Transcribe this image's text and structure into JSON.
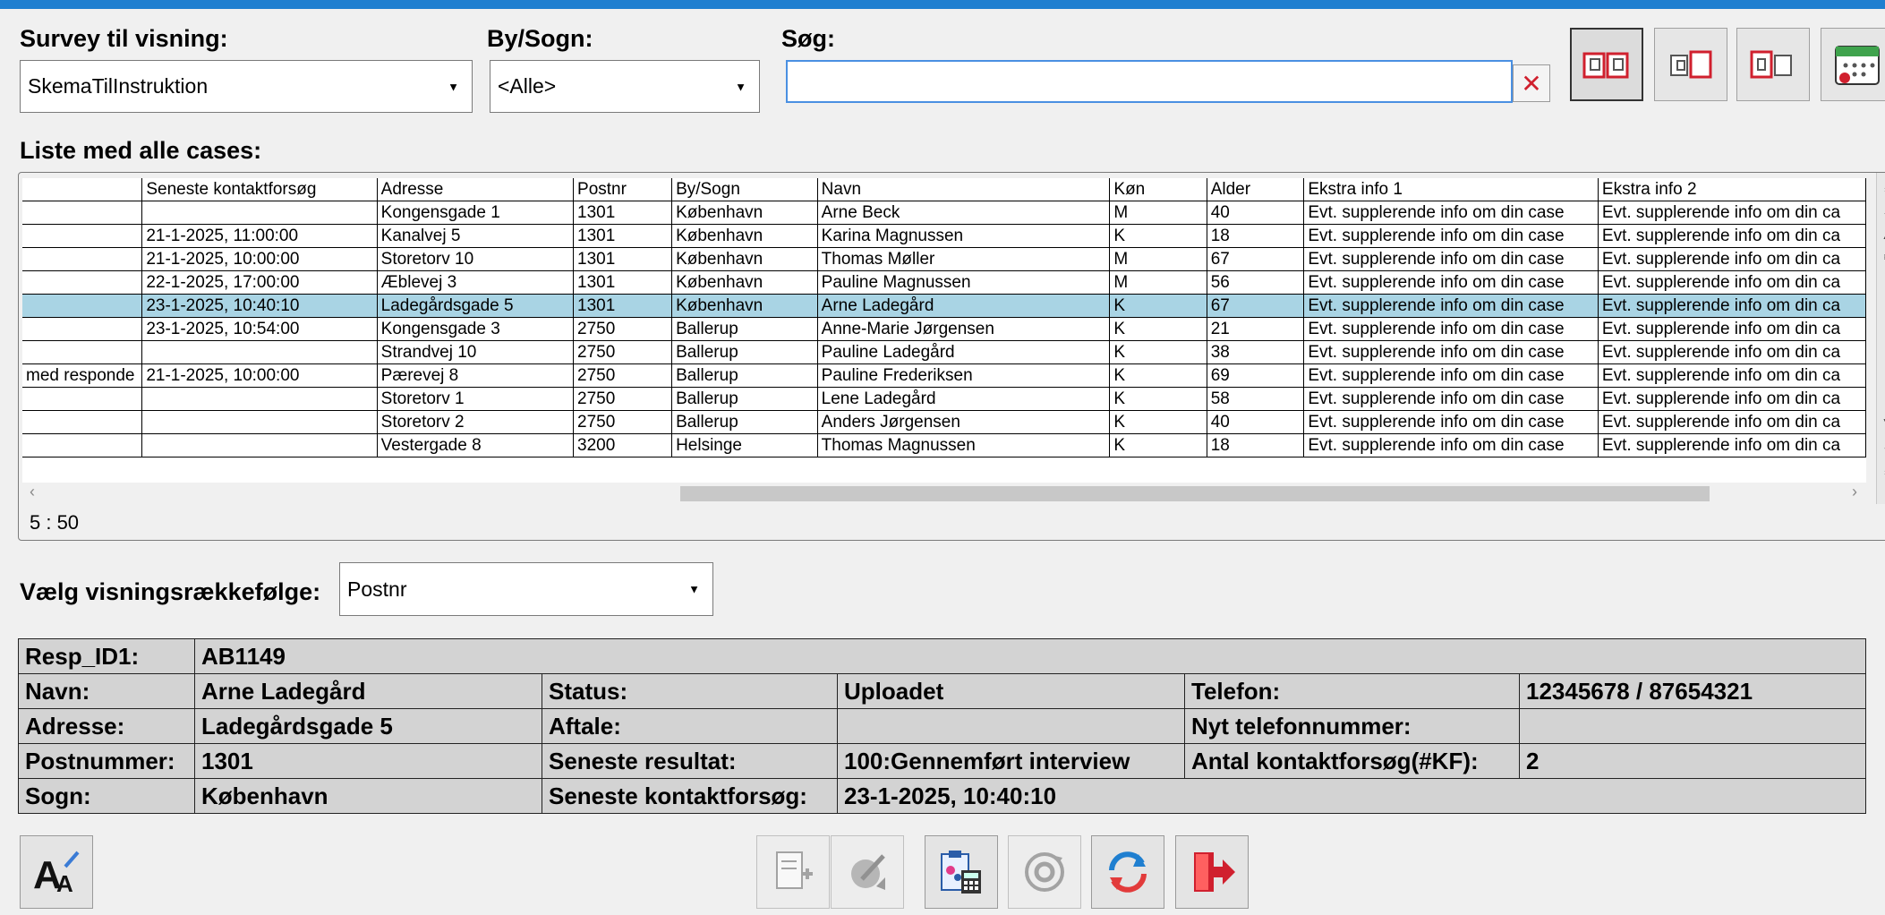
{
  "filters": {
    "survey_label": "Survey til visning:",
    "survey_value": "SkemaTilInstruktion",
    "city_label": "By/Sogn:",
    "city_value": "<Alle>",
    "search_label": "Søg:",
    "search_value": ""
  },
  "list": {
    "title": "Liste med alle cases:",
    "columns": [
      "",
      "Seneste kontaktforsøg",
      "Adresse",
      "Postnr",
      "By/Sogn",
      "Navn",
      "Køn",
      "Alder",
      "Ekstra info 1",
      "Ekstra info 2"
    ],
    "rows": [
      [
        "",
        "",
        "Kongensgade 1",
        "1301",
        "København",
        "Arne Beck",
        "M",
        "40",
        "Evt. supplerende info om din case",
        "Evt. supplerende info om din ca"
      ],
      [
        "",
        "21-1-2025, 11:00:00",
        "Kanalvej 5",
        "1301",
        "København",
        "Karina Magnussen",
        "K",
        "18",
        "Evt. supplerende info om din case",
        "Evt. supplerende info om din ca"
      ],
      [
        "",
        "21-1-2025, 10:00:00",
        "Storetorv 10",
        "1301",
        "København",
        "Thomas Møller",
        "M",
        "67",
        "Evt. supplerende info om din case",
        "Evt. supplerende info om din ca"
      ],
      [
        "",
        "22-1-2025, 17:00:00",
        "Æblevej 3",
        "1301",
        "København",
        "Pauline Magnussen",
        "M",
        "56",
        "Evt. supplerende info om din case",
        "Evt. supplerende info om din ca"
      ],
      [
        "",
        "23-1-2025, 10:40:10",
        "Ladegårdsgade 5",
        "1301",
        "København",
        "Arne Ladegård",
        "K",
        "67",
        "Evt. supplerende info om din case",
        "Evt. supplerende info om din ca"
      ],
      [
        "",
        "23-1-2025, 10:54:00",
        "Kongensgade 3",
        "2750",
        "Ballerup",
        "Anne-Marie Jørgensen",
        "K",
        "21",
        "Evt. supplerende info om din case",
        "Evt. supplerende info om din ca"
      ],
      [
        "",
        "",
        "Strandvej 10",
        "2750",
        "Ballerup",
        "Pauline Ladegård",
        "K",
        "38",
        "Evt. supplerende info om din case",
        "Evt. supplerende info om din ca"
      ],
      [
        "med responde",
        "21-1-2025, 10:00:00",
        "Pærevej 8",
        "2750",
        "Ballerup",
        "Pauline Frederiksen",
        "K",
        "69",
        "Evt. supplerende info om din case",
        "Evt. supplerende info om din ca"
      ],
      [
        "",
        "",
        "Storetorv 1",
        "2750",
        "Ballerup",
        "Lene Ladegård",
        "K",
        "58",
        "Evt. supplerende info om din case",
        "Evt. supplerende info om din ca"
      ],
      [
        "",
        "",
        "Storetorv 2",
        "2750",
        "Ballerup",
        "Anders Jørgensen",
        "K",
        "40",
        "Evt. supplerende info om din case",
        "Evt. supplerende info om din ca"
      ],
      [
        "",
        "",
        "Vestergade 8",
        "3200",
        "Helsinge",
        "Thomas Magnussen",
        "K",
        "18",
        "Evt. supplerende info om din case",
        "Evt. supplerende info om din ca"
      ]
    ],
    "selected_row": 4,
    "counter": "5 : 50"
  },
  "sort": {
    "label": "Vælg visningsrækkefølge:",
    "value": "Postnr"
  },
  "detail": {
    "resp_id_label": "Resp_ID1:",
    "resp_id": "AB1149",
    "name_label": "Navn:",
    "name": "Arne Ladegård",
    "status_label": "Status:",
    "status": "Uploadet",
    "phone_label": "Telefon:",
    "phone": "12345678 / 87654321",
    "address_label": "Adresse:",
    "address": "Ladegårdsgade 5",
    "appointment_label": "Aftale:",
    "appointment": "",
    "new_phone_label": "Nyt telefonnummer:",
    "new_phone": "",
    "postal_label": "Postnummer:",
    "postal": "1301",
    "last_result_label": "Seneste resultat:",
    "last_result": "100:Gennemført interview",
    "attempts_label": "Antal kontaktforsøg(#KF):",
    "attempts": "2",
    "parish_label": "Sogn:",
    "parish": "København",
    "last_contact_label": "Seneste kontaktforsøg:",
    "last_contact": "23-1-2025, 10:40:10"
  },
  "colors": {
    "accent": "#1f7fd0",
    "selected_row": "#a9d4e4",
    "detail_bg": "#d3d3d3",
    "danger": "#d0202e"
  }
}
